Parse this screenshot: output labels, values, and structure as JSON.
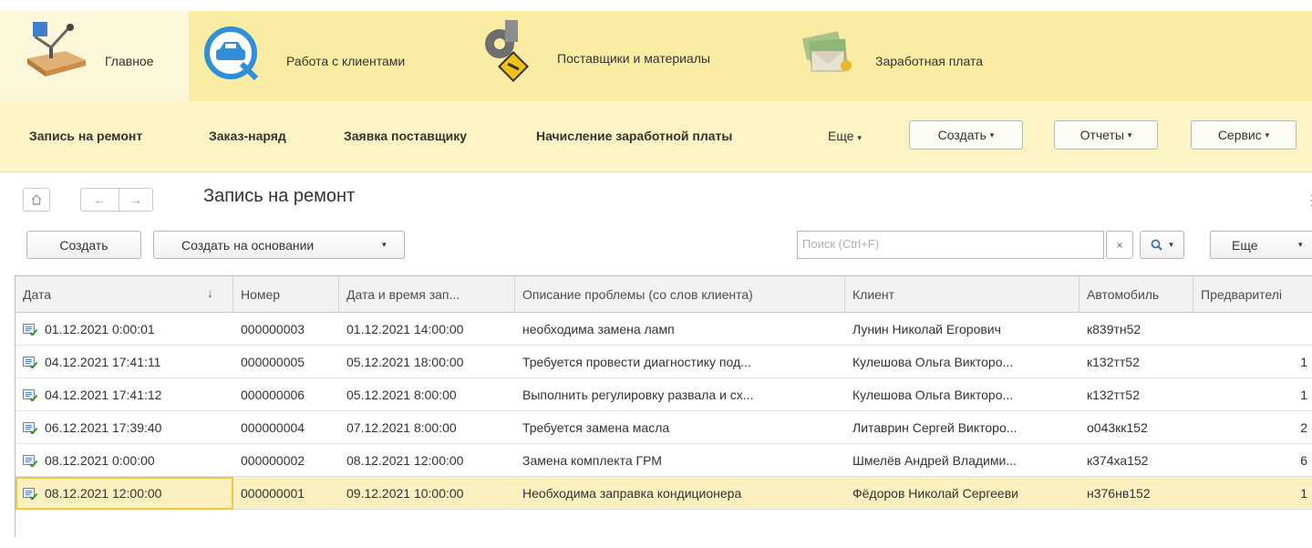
{
  "sections": [
    {
      "label": "Главное",
      "icon": "desk-lamp-icon",
      "active": true
    },
    {
      "label": "Работа с клиентами",
      "icon": "car-service-icon",
      "active": false
    },
    {
      "label": "Поставщики и материалы",
      "icon": "gears-tools-icon",
      "active": false
    },
    {
      "label": "Заработная плата",
      "icon": "money-envelope-icon",
      "active": false
    }
  ],
  "funcbar": {
    "items": [
      "Запись на ремонт",
      "Заказ-наряд",
      "Заявка поставщику",
      "Начисление заработной платы"
    ],
    "more": "Еще",
    "create": "Создать",
    "reports": "Отчеты",
    "service": "Сервис"
  },
  "form": {
    "title": "Запись на ремонт",
    "create_btn": "Создать",
    "create_based_btn": "Создать на основании",
    "search_placeholder": "Поиск (Ctrl+F)",
    "more_btn": "Еще"
  },
  "table": {
    "columns": [
      "Дата",
      "Номер",
      "Дата и время зап...",
      "Описание проблемы (со слов клиента)",
      "Клиент",
      "Автомобиль",
      "Предварителі"
    ],
    "rows": [
      {
        "date": "01.12.2021 0:00:01",
        "number": "000000003",
        "datetime": "01.12.2021 14:00:00",
        "problem": "необходима замена ламп",
        "client": "Лунин Николай Егорович",
        "car": "к839тн52",
        "pre": ""
      },
      {
        "date": "04.12.2021 17:41:11",
        "number": "000000005",
        "datetime": "05.12.2021 18:00:00",
        "problem": "Требуется провести диагностику под...",
        "client": "Кулешова Ольга Викторо...",
        "car": "к132тт52",
        "pre": "1"
      },
      {
        "date": "04.12.2021 17:41:12",
        "number": "000000006",
        "datetime": "05.12.2021 8:00:00",
        "problem": "Выполнить регулировку развала и сх...",
        "client": "Кулешова Ольга Викторо...",
        "car": "к132тт52",
        "pre": "1"
      },
      {
        "date": "06.12.2021 17:39:40",
        "number": "000000004",
        "datetime": "07.12.2021 8:00:00",
        "problem": "Требуется замена масла",
        "client": "Литаврин Сергей Викторо...",
        "car": "о043кк152",
        "pre": "2"
      },
      {
        "date": "08.12.2021 0:00:00",
        "number": "000000002",
        "datetime": "08.12.2021 12:00:00",
        "problem": "Замена комплекта ГРМ",
        "client": "Шмелёв Андрей Владими...",
        "car": "к374ха152",
        "pre": "6"
      },
      {
        "date": "08.12.2021 12:00:00",
        "number": "000000001",
        "datetime": "09.12.2021 10:00:00",
        "problem": "Необходима заправка кондиционера",
        "client": "Фёдоров Николай Сергееви",
        "car": "н376нв152",
        "pre": "1",
        "selected": true
      }
    ]
  }
}
